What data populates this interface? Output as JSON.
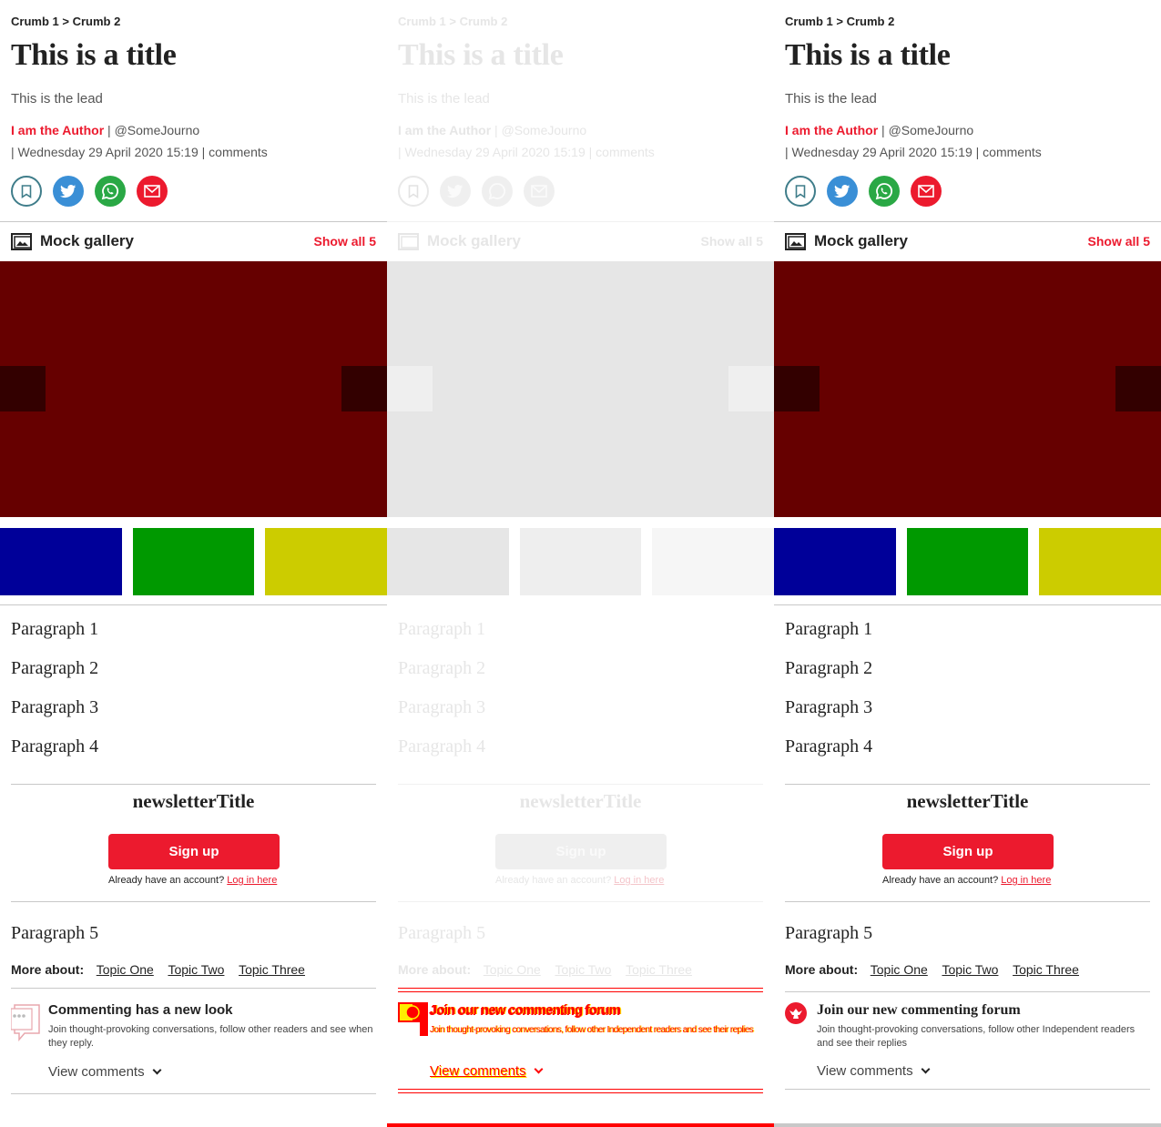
{
  "panels": [
    {
      "breadcrumb": {
        "crumb1": "Crumb 1",
        "separator": ">",
        "crumb2": "Crumb 2"
      },
      "title": "This is a title",
      "lead": "This is the lead",
      "byline": {
        "author": "I am the Author",
        "handle": "| @SomeJourno"
      },
      "dateline": {
        "date": "| Wednesday 29 April 2020 15:19 |",
        "comments": "comments"
      },
      "share": [
        "bookmark-icon",
        "twitter-icon",
        "whatsapp-icon",
        "email-icon"
      ],
      "gallery": {
        "title": "Mock gallery",
        "show_all": "Show all 5",
        "main_color": "#660000",
        "thumb_colors": [
          "#000099",
          "#009900",
          "#cccc00"
        ]
      },
      "paragraphs": [
        "Paragraph 1",
        "Paragraph 2",
        "Paragraph 3",
        "Paragraph 4"
      ],
      "newsletter": {
        "title": "newsletterTitle",
        "signup": "Sign up",
        "login_prompt": "Already have an account?",
        "login_link": "Log in here"
      },
      "paragraph5": "Paragraph 5",
      "more_about": {
        "label": "More about:",
        "topics": [
          "Topic One",
          "Topic Two",
          "Topic Three"
        ]
      },
      "comments": {
        "title": "Commenting has a new look",
        "body": "Join thought-provoking conversations, follow other readers and see when they reply.",
        "view": "View comments"
      }
    },
    {
      "breadcrumb": {
        "crumb1": "Crumb 1",
        "separator": ">",
        "crumb2": "Crumb 2"
      },
      "title": "This is a title",
      "lead": "This is the lead",
      "byline": {
        "author": "I am the Author",
        "handle": "| @SomeJourno"
      },
      "dateline": {
        "date": "| Wednesday 29 April 2020 15:19 |",
        "comments": "comments"
      },
      "gallery": {
        "title": "Mock gallery",
        "show_all": "Show all 5"
      },
      "paragraphs": [
        "Paragraph 1",
        "Paragraph 2",
        "Paragraph 3",
        "Paragraph 4"
      ],
      "newsletter": {
        "title": "newsletterTitle",
        "signup": "Sign up",
        "login_prompt": "Already have an account?",
        "login_link": "Log in here"
      },
      "paragraph5": "Paragraph 5",
      "more_about": {
        "label": "More about:",
        "topics": [
          "Topic One",
          "Topic Two",
          "Topic Three"
        ]
      },
      "comments": {
        "title": "Join our new commenting forum",
        "body": "Join thought-provoking conversations, follow other Independent readers and see their replies",
        "view": "View comments"
      },
      "bottom_bar_color": "#ff0000"
    },
    {
      "breadcrumb": {
        "crumb1": "Crumb 1",
        "separator": ">",
        "crumb2": "Crumb 2"
      },
      "title": "This is a title",
      "lead": "This is the lead",
      "byline": {
        "author": "I am the Author",
        "handle": "| @SomeJourno"
      },
      "dateline": {
        "date": "| Wednesday 29 April 2020 15:19 |",
        "comments": "comments"
      },
      "gallery": {
        "title": "Mock gallery",
        "show_all": "Show all 5"
      },
      "paragraphs": [
        "Paragraph 1",
        "Paragraph 2",
        "Paragraph 3",
        "Paragraph 4"
      ],
      "newsletter": {
        "title": "newsletterTitle",
        "signup": "Sign up",
        "login_prompt": "Already have an account?",
        "login_link": "Log in here"
      },
      "paragraph5": "Paragraph 5",
      "more_about": {
        "label": "More about:",
        "topics": [
          "Topic One",
          "Topic Two",
          "Topic Three"
        ]
      },
      "comments": {
        "title": "Join our new commenting forum",
        "body": "Join thought-provoking conversations, follow other Independent readers and see their replies",
        "view": "View comments"
      },
      "bottom_bar_color": "#c8c8c8"
    }
  ],
  "colors": {
    "accent": "#ec1a2e",
    "skeleton": "#e6e6e6",
    "glitch_red": "#ff0000",
    "glitch_yellow": "#ffee00"
  }
}
